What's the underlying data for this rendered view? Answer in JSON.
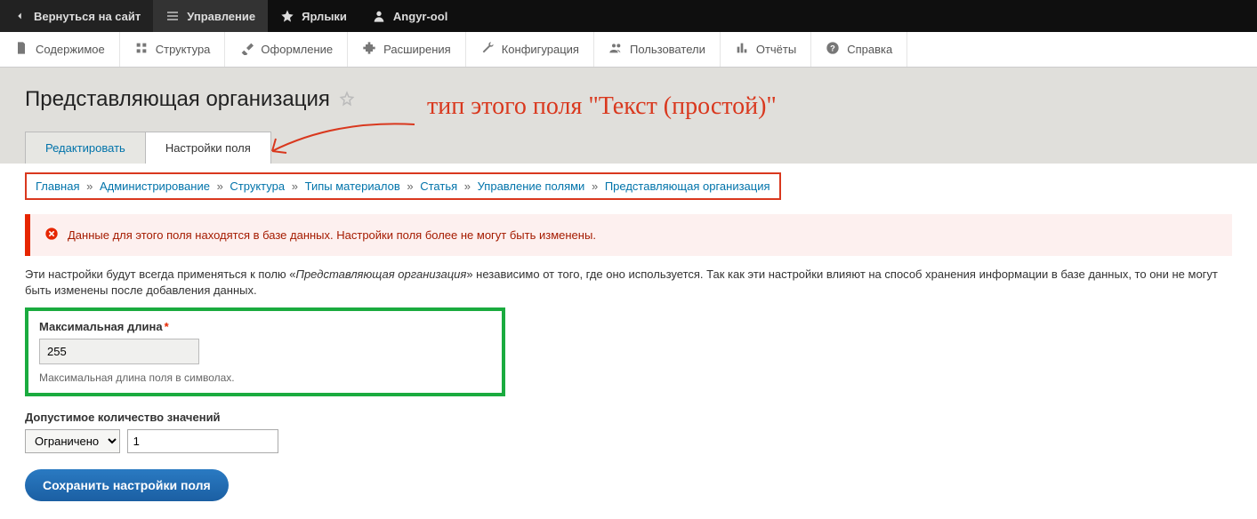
{
  "topbar": {
    "back": "Вернуться на сайт",
    "manage": "Управление",
    "shortcuts": "Ярлыки",
    "user": "Angyr-ool"
  },
  "adminbar": {
    "content": "Содержимое",
    "structure": "Структура",
    "appearance": "Оформление",
    "extend": "Расширения",
    "config": "Конфигурация",
    "people": "Пользователи",
    "reports": "Отчёты",
    "help": "Справка"
  },
  "page_title": "Представляющая организация",
  "annotation": "тип этого поля \"Текст (простой)\"",
  "tabs": {
    "edit": "Редактировать",
    "field_settings": "Настройки поля"
  },
  "breadcrumb": {
    "home": "Главная",
    "admin": "Администрирование",
    "structure": "Структура",
    "types": "Типы материалов",
    "article": "Статья",
    "manage_fields": "Управление полями",
    "current": "Представляющая организация"
  },
  "warning": "Данные для этого поля находятся в базе данных. Настройки поля более не могут быть изменены.",
  "body_text_pre": "Эти настройки будут всегда применяться к полю «",
  "body_text_em": "Представляющая организация",
  "body_text_post": "» независимо от того, где оно используется. Так как эти настройки влияют на способ хранения информации в базе данных, то они не могут быть изменены после добавления данных.",
  "max_length": {
    "label": "Максимальная длина",
    "value": "255",
    "help": "Максимальная длина поля в символах."
  },
  "allowed_values": {
    "label": "Допустимое количество значений",
    "select_value": "Ограничено",
    "num_value": "1"
  },
  "save_button": "Сохранить настройки поля"
}
